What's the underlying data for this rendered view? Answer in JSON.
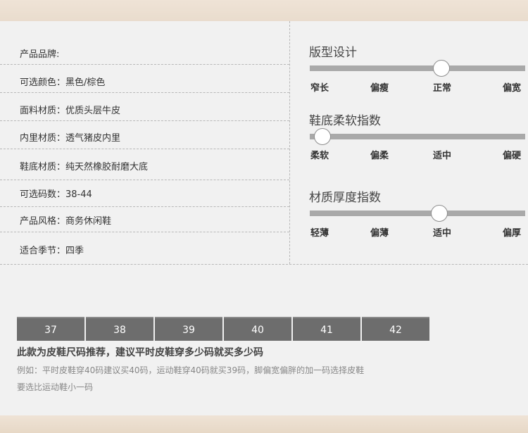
{
  "specs": [
    {
      "label": "产品品牌:"
    },
    {
      "label": "可选颜色：黑色/棕色"
    },
    {
      "label": "面料材质：优质头层牛皮"
    },
    {
      "label": "内里材质：透气猪皮内里"
    },
    {
      "label": "鞋底材质：纯天然橡胶耐磨大底"
    },
    {
      "label": "可选码数：38-44"
    },
    {
      "label": "产品风格：商务休闲鞋"
    },
    {
      "label": "适合季节：四季"
    }
  ],
  "sliders": [
    {
      "title": "版型设计",
      "ticks": [
        "窄长",
        "偏瘦",
        "正常",
        "偏宽"
      ],
      "level": 0.62
    },
    {
      "title": "鞋底柔软指数",
      "ticks": [
        "柔软",
        "偏柔",
        "适中",
        "偏硬"
      ],
      "level": 0.02
    },
    {
      "title": "材质厚度指数",
      "ticks": [
        "轻薄",
        "偏薄",
        "适中",
        "偏厚"
      ],
      "level": 0.61
    }
  ],
  "sizes": [
    "37",
    "38",
    "39",
    "40",
    "41",
    "42"
  ],
  "note": {
    "title": "此款为皮鞋尺码推荐，建议平时皮鞋穿多少码就买多少码",
    "line1": "例如：平时皮鞋穿40码建议买40码，运动鞋穿40码就买39码，脚偏宽偏胖的加一码选择皮鞋",
    "line2": "要选比运动鞋小一码"
  },
  "colors": {
    "band": "#ecdfd0",
    "panel": "#f1f1f1",
    "track": "#a9a9a9",
    "size_cell": "#6d6d6d"
  }
}
